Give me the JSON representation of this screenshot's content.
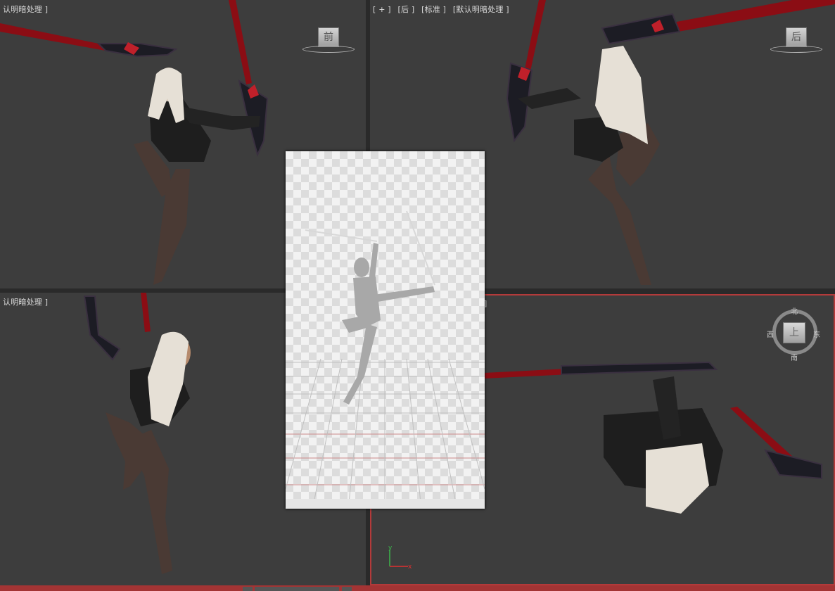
{
  "viewports": {
    "top_left": {
      "label_parts": [
        "认明暗处理 ]"
      ]
    },
    "top_right": {
      "label_parts": [
        "[ + ]",
        "[后 ]",
        "[标准 ]",
        "[默认明暗处理 ]"
      ]
    },
    "bottom_left": {
      "label_parts": [
        "认明暗处理 ]"
      ]
    },
    "bottom_right": {
      "label_parts": [
        "]"
      ]
    }
  },
  "viewcubes": {
    "front": "前",
    "back": "后",
    "top": "上"
  },
  "compass": {
    "north": "北",
    "south": "南",
    "east": "东",
    "west": "西"
  },
  "axis": {
    "y": "y",
    "x": "x"
  },
  "colors": {
    "viewport_bg": "#3d3d3d",
    "active_border": "#b33a3a",
    "weapon_red": "#8b0d14",
    "skin": "#e8dcd0",
    "hair": "#e6e0d6",
    "outfit": "#1e1e1e",
    "stockings": "#4a3a34"
  }
}
